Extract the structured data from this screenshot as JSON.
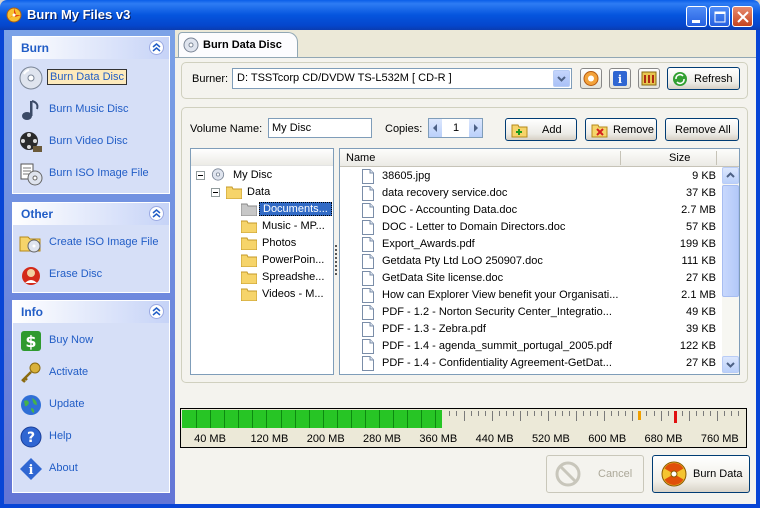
{
  "window": {
    "title": "Burn My Files v3"
  },
  "sidebar": {
    "burn": {
      "header": "Burn",
      "items": [
        {
          "label": "Burn Data Disc",
          "icon": "data-disc-icon"
        },
        {
          "label": "Burn Music Disc",
          "icon": "music-note-icon"
        },
        {
          "label": "Burn Video Disc",
          "icon": "film-reel-icon"
        },
        {
          "label": "Burn ISO Image File",
          "icon": "iso-disc-icon"
        }
      ]
    },
    "other": {
      "header": "Other",
      "items": [
        {
          "label": "Create ISO Image File",
          "icon": "create-iso-icon"
        },
        {
          "label": "Erase Disc",
          "icon": "erase-icon"
        }
      ]
    },
    "info": {
      "header": "Info",
      "items": [
        {
          "label": "Buy Now",
          "icon": "dollar-icon"
        },
        {
          "label": "Activate",
          "icon": "key-icon"
        },
        {
          "label": "Update",
          "icon": "globe-icon"
        },
        {
          "label": "Help",
          "icon": "help-icon"
        },
        {
          "label": "About",
          "icon": "info-icon"
        }
      ]
    }
  },
  "tab": {
    "label": "Burn Data Disc"
  },
  "burner": {
    "label": "Burner:",
    "value": "D: TSSTcorp CD/DVDW TS-L532M [ CD-R ]",
    "refresh_label": "Refresh"
  },
  "volume": {
    "name_label": "Volume Name:",
    "name_value": "My Disc",
    "copies_label": "Copies:",
    "copies_value": "1"
  },
  "actions": {
    "add": "Add",
    "remove": "Remove",
    "remove_all": "Remove All"
  },
  "tree": {
    "root": "My Disc",
    "data": "Data",
    "children": [
      "Documents...",
      "Music - MP...",
      "Photos",
      "PowerPoin...",
      "Spreadshe...",
      "Videos - M..."
    ]
  },
  "files": {
    "columns": {
      "name": "Name",
      "size": "Size"
    },
    "rows": [
      {
        "name": "38605.jpg",
        "size": "9 KB"
      },
      {
        "name": "data recovery service.doc",
        "size": "37 KB"
      },
      {
        "name": "DOC - Accounting Data.doc",
        "size": "2.7 MB"
      },
      {
        "name": "DOC - Letter to Domain Directors.doc",
        "size": "57 KB"
      },
      {
        "name": "Export_Awards.pdf",
        "size": "199 KB"
      },
      {
        "name": "Getdata Pty Ltd LoO 250907.doc",
        "size": "111 KB"
      },
      {
        "name": "GetData Site license.doc",
        "size": "27 KB"
      },
      {
        "name": "How can Explorer View benefit your Organisati...",
        "size": "2.1 MB"
      },
      {
        "name": "PDF - 1.2 - Norton Security Center_Integratio...",
        "size": "49 KB"
      },
      {
        "name": "PDF - 1.3 - Zebra.pdf",
        "size": "39 KB"
      },
      {
        "name": "PDF - 1.4 - agenda_summit_portugal_2005.pdf",
        "size": "122 KB"
      },
      {
        "name": "PDF - 1.4 - Confidentiality Agreement-GetDat...",
        "size": "27 KB"
      }
    ]
  },
  "capacity": {
    "used_mb": 370,
    "max_mb": 800,
    "warning_mb": 650,
    "limit_mb": 700,
    "labels": [
      "40 MB",
      "120 MB",
      "200 MB",
      "280 MB",
      "360 MB",
      "440 MB",
      "520 MB",
      "600 MB",
      "680 MB",
      "760 MB"
    ],
    "fill_color": "#27c525",
    "warning_color": "#f0a000",
    "limit_color": "#e01010"
  },
  "footer": {
    "cancel": "Cancel",
    "burn": "Burn Data"
  }
}
